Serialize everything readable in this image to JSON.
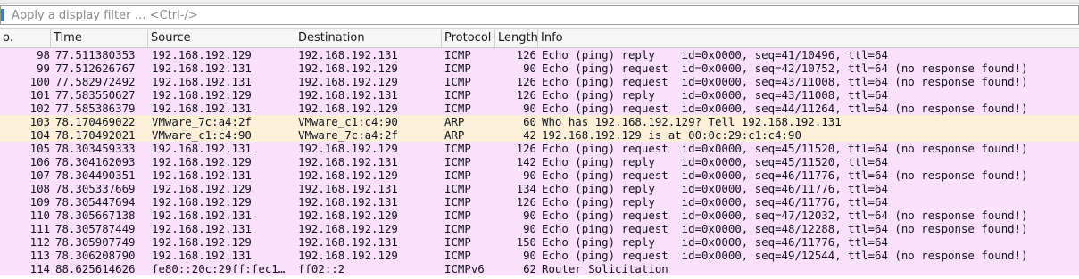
{
  "filter": {
    "placeholder": "Apply a display filter … <Ctrl-/>"
  },
  "columns": {
    "no": "o.",
    "time": "Time",
    "source": "Source",
    "destination": "Destination",
    "protocol": "Protocol",
    "length": "Length",
    "info": "Info"
  },
  "colors": {
    "icmp": "#fbe0fd",
    "arp": "#fcf0d8",
    "ipv6": "#fbe0fd"
  },
  "packets": [
    {
      "no": "98",
      "time": "77.511380353",
      "src": "192.168.192.129",
      "dst": "192.168.192.131",
      "proto": "ICMP",
      "len": "126",
      "info": "Echo (ping) reply    id=0x0000, seq=41/10496, ttl=64",
      "kind": "icmp"
    },
    {
      "no": "99",
      "time": "77.512626767",
      "src": "192.168.192.131",
      "dst": "192.168.192.129",
      "proto": "ICMP",
      "len": "90",
      "info": "Echo (ping) request  id=0x0000, seq=42/10752, ttl=64 (no response found!)",
      "kind": "icmp"
    },
    {
      "no": "100",
      "time": "77.582972492",
      "src": "192.168.192.131",
      "dst": "192.168.192.129",
      "proto": "ICMP",
      "len": "126",
      "info": "Echo (ping) request  id=0x0000, seq=43/11008, ttl=64 (no response found!)",
      "kind": "icmp"
    },
    {
      "no": "101",
      "time": "77.583550627",
      "src": "192.168.192.129",
      "dst": "192.168.192.131",
      "proto": "ICMP",
      "len": "126",
      "info": "Echo (ping) reply    id=0x0000, seq=43/11008, ttl=64",
      "kind": "icmp"
    },
    {
      "no": "102",
      "time": "77.585386379",
      "src": "192.168.192.131",
      "dst": "192.168.192.129",
      "proto": "ICMP",
      "len": "90",
      "info": "Echo (ping) request  id=0x0000, seq=44/11264, ttl=64 (no response found!)",
      "kind": "icmp"
    },
    {
      "no": "103",
      "time": "78.170469022",
      "src": "VMware_7c:a4:2f",
      "dst": "VMware_c1:c4:90",
      "proto": "ARP",
      "len": "60",
      "info": "Who has 192.168.192.129? Tell 192.168.192.131",
      "kind": "arp"
    },
    {
      "no": "104",
      "time": "78.170492021",
      "src": "VMware_c1:c4:90",
      "dst": "VMware_7c:a4:2f",
      "proto": "ARP",
      "len": "42",
      "info": "192.168.192.129 is at 00:0c:29:c1:c4:90",
      "kind": "arp"
    },
    {
      "no": "105",
      "time": "78.303459333",
      "src": "192.168.192.131",
      "dst": "192.168.192.129",
      "proto": "ICMP",
      "len": "126",
      "info": "Echo (ping) request  id=0x0000, seq=45/11520, ttl=64 (no response found!)",
      "kind": "icmp"
    },
    {
      "no": "106",
      "time": "78.304162093",
      "src": "192.168.192.129",
      "dst": "192.168.192.131",
      "proto": "ICMP",
      "len": "142",
      "info": "Echo (ping) reply    id=0x0000, seq=45/11520, ttl=64",
      "kind": "icmp"
    },
    {
      "no": "107",
      "time": "78.304490351",
      "src": "192.168.192.131",
      "dst": "192.168.192.129",
      "proto": "ICMP",
      "len": "90",
      "info": "Echo (ping) request  id=0x0000, seq=46/11776, ttl=64 (no response found!)",
      "kind": "icmp"
    },
    {
      "no": "108",
      "time": "78.305337669",
      "src": "192.168.192.129",
      "dst": "192.168.192.131",
      "proto": "ICMP",
      "len": "134",
      "info": "Echo (ping) reply    id=0x0000, seq=46/11776, ttl=64",
      "kind": "icmp"
    },
    {
      "no": "109",
      "time": "78.305447694",
      "src": "192.168.192.129",
      "dst": "192.168.192.131",
      "proto": "ICMP",
      "len": "126",
      "info": "Echo (ping) reply    id=0x0000, seq=46/11776, ttl=64",
      "kind": "icmp"
    },
    {
      "no": "110",
      "time": "78.305667138",
      "src": "192.168.192.131",
      "dst": "192.168.192.129",
      "proto": "ICMP",
      "len": "90",
      "info": "Echo (ping) request  id=0x0000, seq=47/12032, ttl=64 (no response found!)",
      "kind": "icmp"
    },
    {
      "no": "111",
      "time": "78.305787449",
      "src": "192.168.192.131",
      "dst": "192.168.192.129",
      "proto": "ICMP",
      "len": "90",
      "info": "Echo (ping) request  id=0x0000, seq=48/12288, ttl=64 (no response found!)",
      "kind": "icmp"
    },
    {
      "no": "112",
      "time": "78.305907749",
      "src": "192.168.192.129",
      "dst": "192.168.192.131",
      "proto": "ICMP",
      "len": "150",
      "info": "Echo (ping) reply    id=0x0000, seq=46/11776, ttl=64",
      "kind": "icmp"
    },
    {
      "no": "113",
      "time": "78.306208790",
      "src": "192.168.192.131",
      "dst": "192.168.192.129",
      "proto": "ICMP",
      "len": "90",
      "info": "Echo (ping) request  id=0x0000, seq=49/12544, ttl=64 (no response found!)",
      "kind": "icmp"
    },
    {
      "no": "114",
      "time": "88.625614626",
      "src": "fe80::20c:29ff:fec1…",
      "dst": "ff02::2",
      "proto": "ICMPv6",
      "len": "62",
      "info": "Router Solicitation",
      "kind": "ipv6"
    }
  ]
}
